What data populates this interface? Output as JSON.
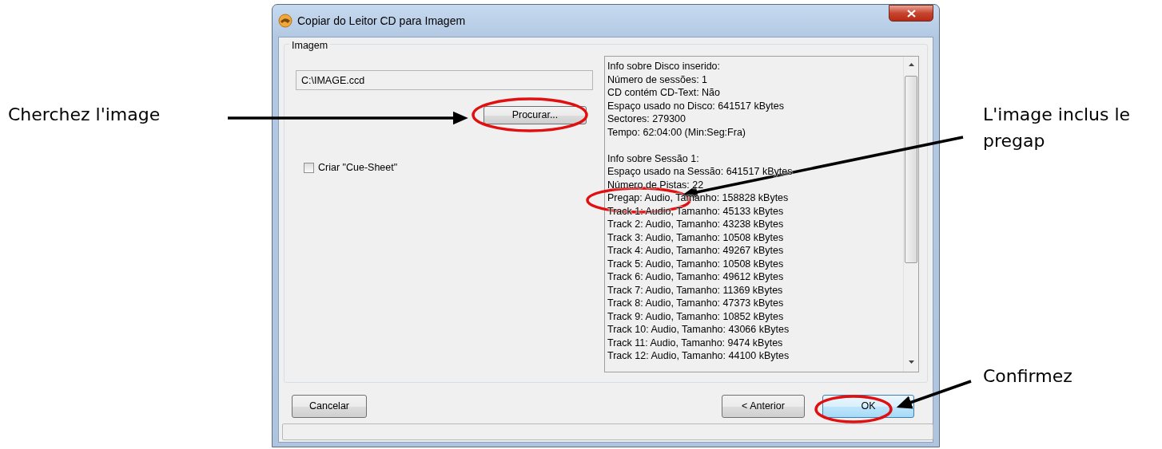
{
  "window": {
    "title": "Copiar do Leitor CD para Imagem"
  },
  "group": {
    "legend": "Imagem"
  },
  "path_field": {
    "value": "C:\\IMAGE.ccd"
  },
  "browse_button": {
    "label": "Procurar..."
  },
  "cue_sheet": {
    "label": "Criar \"Cue-Sheet\"",
    "checked": false
  },
  "info": {
    "disc_lines": [
      "Info sobre Disco inserido:",
      "Número de sessões: 1",
      "CD contém CD-Text: Não",
      "Espaço usado no Disco: 641517 kBytes",
      "Sectores: 279300",
      "Tempo: 62:04:00 (Min:Seg:Fra)"
    ],
    "session_lines": [
      "Info sobre Sessão 1:",
      "Espaço usado na Sessão: 641517 kBytes",
      "Número de Pistas: 22",
      "Pregap: Audio, Tamanho: 158828 kBytes",
      "Track 1: Audio, Tamanho: 45133 kBytes",
      "Track 2: Audio, Tamanho: 43238 kBytes",
      "Track 3: Audio, Tamanho: 10508 kBytes",
      "Track 4: Audio, Tamanho: 49267 kBytes",
      "Track 5: Audio, Tamanho: 10508 kBytes",
      "Track 6: Audio, Tamanho: 49612 kBytes",
      "Track 7: Audio, Tamanho: 11369 kBytes",
      "Track 8: Audio, Tamanho: 47373 kBytes",
      "Track 9: Audio, Tamanho: 10852 kBytes",
      "Track 10: Audio, Tamanho: 43066 kBytes",
      "Track 11: Audio, Tamanho: 9474 kBytes",
      "Track 12: Audio, Tamanho: 44100 kBytes"
    ]
  },
  "buttons": [
    {
      "label": "Cancelar",
      "kind": "plain"
    },
    {
      "label": "< Anterior",
      "kind": "plain"
    },
    {
      "label": "OK",
      "kind": "default"
    }
  ],
  "annotations": [
    {
      "text": "Cherchez l'image"
    },
    {
      "text": "L'image inclus le pregap"
    },
    {
      "text": "Confirmez"
    }
  ]
}
